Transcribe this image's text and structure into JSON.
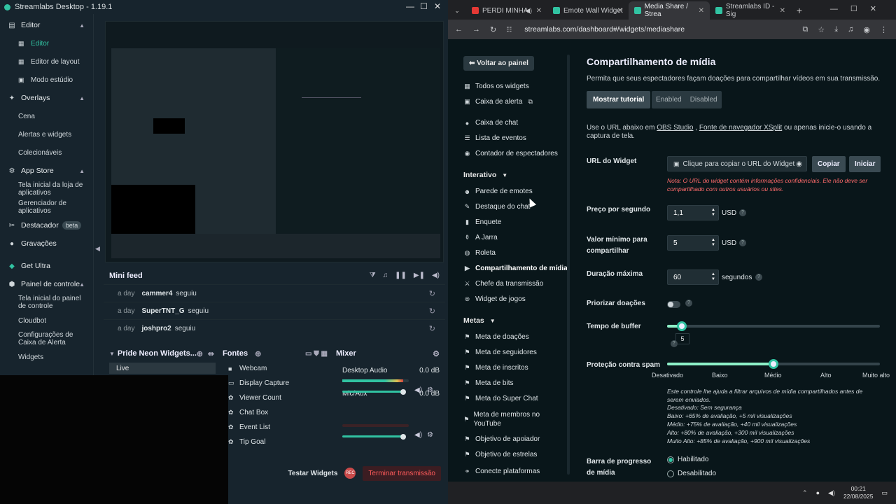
{
  "app": {
    "title": "Streamlabs Desktop - 1.19.1",
    "window_controls": {
      "minimize": "—",
      "maximize": "☐",
      "close": "✕"
    },
    "sidebar": {
      "groups": [
        {
          "label": "Editor",
          "items": [
            {
              "label": "Editor"
            },
            {
              "label": "Editor de layout"
            },
            {
              "label": "Modo estúdio"
            }
          ]
        },
        {
          "label": "Overlays",
          "items": [
            {
              "label": "Cena"
            },
            {
              "label": "Alertas e widgets"
            },
            {
              "label": "Colecionáveis"
            }
          ]
        },
        {
          "label": "App Store",
          "items": [
            {
              "label": "Tela inicial da loja de aplicativos"
            },
            {
              "label": "Gerenciador de aplicativos"
            }
          ]
        }
      ],
      "destacador": "Destacador",
      "beta": "beta",
      "gravacoes": "Gravações",
      "get_ultra": "Get Ultra",
      "painel": {
        "label": "Painel de controle",
        "items": [
          {
            "label": "Tela inicial do painel de controle"
          },
          {
            "label": "Cloudbot"
          },
          {
            "label": "Configurações de Caixa de Alerta"
          },
          {
            "label": "Widgets"
          }
        ]
      }
    },
    "mini_feed": {
      "title": "Mini feed",
      "rows": [
        {
          "time": "a day",
          "name": "cammer4",
          "event": "seguiu"
        },
        {
          "time": "a day",
          "name": "SuperTNT_G",
          "event": "seguiu"
        },
        {
          "time": "a day",
          "name": "joshpro2",
          "event": "seguiu"
        }
      ]
    },
    "scenes": {
      "title": "Pride Neon Widgets...",
      "live": "Live"
    },
    "sources": {
      "title": "Fontes",
      "items": [
        "Webcam",
        "Display Capture",
        "Viewer Count",
        "Chat Box",
        "Event List",
        "Tip Goal"
      ]
    },
    "mixer": {
      "title": "Mixer",
      "channels": [
        {
          "name": "Desktop Audio",
          "db": "0.0 dB",
          "level": 0.92
        },
        {
          "name": "Mic/Aux",
          "db": "0.0 dB",
          "level": 0.92
        }
      ]
    },
    "footer": {
      "test_widgets": "Testar Widgets",
      "rec": "REC",
      "end_stream": "Terminar transmissão"
    }
  },
  "browser": {
    "tabs": [
      {
        "title": "PERDI MINHA",
        "color": "#e53935",
        "active": false
      },
      {
        "title": "Emote Wall Widget",
        "color": "#31c3a2",
        "active": false
      },
      {
        "title": "Media Share / Strea",
        "color": "#31c3a2",
        "active": true
      },
      {
        "title": "Streamlabs ID - Sig",
        "color": "#31c3a2",
        "active": false
      }
    ],
    "url": "streamlabs.com/dashboard#/widgets/mediashare",
    "nav": {
      "back": "Voltar ao painel",
      "top_items": [
        "Todos os widgets",
        "Caixa de alerta",
        "Caixa de chat",
        "Lista de eventos",
        "Contador de espectadores"
      ],
      "interativo_label": "Interativo",
      "interativo_items": [
        "Parede de emotes",
        "Destaque do chat",
        "Enquete",
        "A Jarra",
        "Roleta",
        "Compartilhamento de mídia",
        "Chefe da transmissão",
        "Widget de jogos"
      ],
      "metas_label": "Metas",
      "metas_items": [
        "Meta de doações",
        "Meta de seguidores",
        "Meta de inscritos",
        "Meta de bits",
        "Meta do Super Chat",
        "Meta de membros no YouTube",
        "Objetivo de apoiador",
        "Objetivo de estrelas",
        "Conecte plataformas"
      ]
    },
    "main": {
      "title": "Compartilhamento de mídia",
      "subtitle": "Permita que seus espectadores façam doações para compartilhar vídeos em sua transmissão.",
      "tutorial": "Mostrar tutorial",
      "enabled": "Enabled",
      "disabled": "Disabled",
      "use_url_pre": "Use o URL abaixo em ",
      "obs": "OBS Studio",
      "comma": " , ",
      "xsplit": "Fonte de navegador XSplit",
      "use_url_post": " ou apenas inicie-o usando a captura de tela.",
      "widget_url_label": "URL do Widget",
      "widget_url_field": "Clique para copiar o URL do Widget",
      "copy": "Copiar",
      "start": "Iniciar",
      "note": "Nota: O URL do widget contém informações confidenciais. Ele não deve ser compartilhado com outros usuários ou sites.",
      "price_label": "Preço por segundo",
      "price_value": "1,1",
      "usd": "USD",
      "min_label": "Valor mínimo para compartilhar",
      "min_value": "5",
      "max_label": "Duração máxima",
      "max_value": "60",
      "seconds": "segundos",
      "prioritize_label": "Priorizar doações",
      "buffer_label": "Tempo de buffer",
      "buffer_value": "5",
      "buffer_fraction": 0.07,
      "spam_label": "Proteção contra spam",
      "spam_levels": [
        "Desativado",
        "Baixo",
        "Médio",
        "Alto",
        "Muito alto"
      ],
      "spam_fraction": 0.5,
      "spam_info": [
        "Este controle lhe ajuda a filtrar arquivos de mídia compartilhados antes de serem enviados.",
        "Desativado: Sem segurança",
        "Baixo: +65% de avaliação, +5 mil visualizações",
        "Médio: +75% de avaliação, +40 mil visualizações",
        "Alto: +80% de avaliação, +300 mil visualizações",
        "Muito Alto: +85% de avaliação, +900 mil visualizações"
      ],
      "progress_label": "Barra de progresso de mídia",
      "progress_on": "Habilitado",
      "progress_off": "Desabilitado"
    }
  },
  "taskbar": {
    "time": "00:21",
    "date": "22/08/2025"
  }
}
